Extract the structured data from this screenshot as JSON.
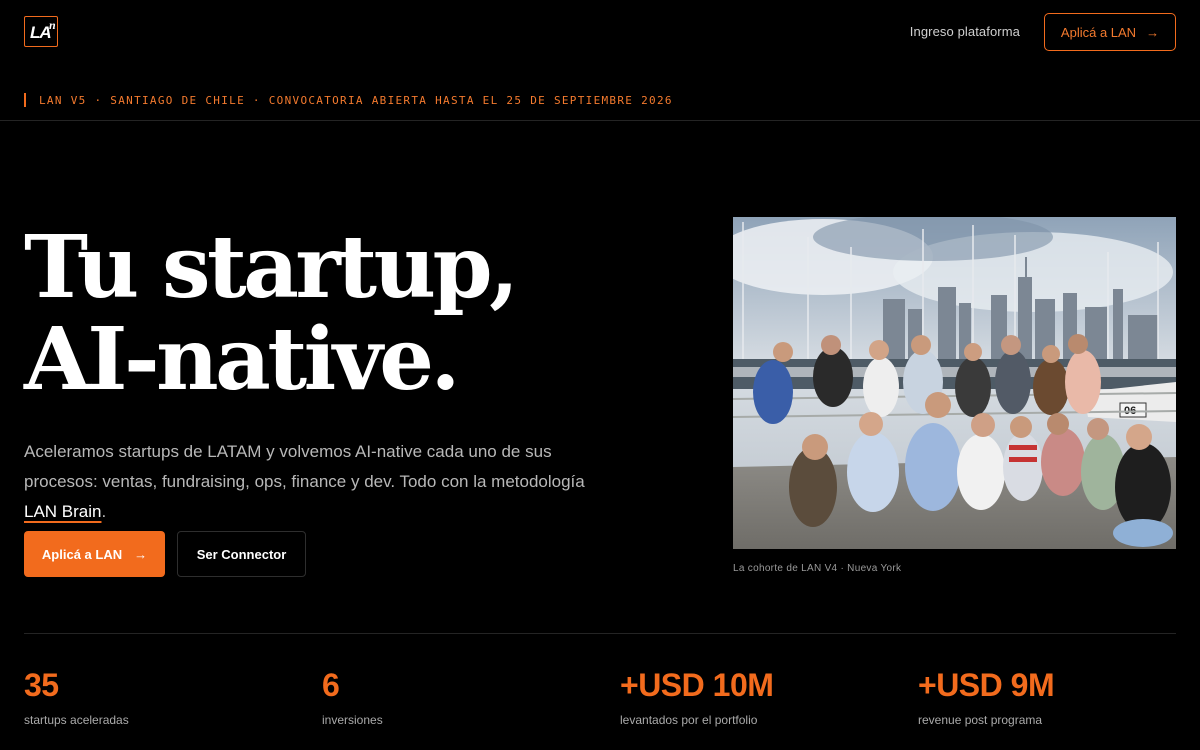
{
  "header": {
    "logo_text": "LA",
    "logo_sup": "n",
    "login_label": "Ingreso plataforma",
    "apply_label": "Aplicá a LAN",
    "apply_icon": "arrow-right-icon"
  },
  "announcement": "LAN V5 · SANTIAGO DE CHILE · CONVOCATORIA ABIERTA HASTA EL 25 DE SEPTIEMBRE 2026",
  "hero": {
    "title_line1": "Tu startup,",
    "title_line2": "AI-native.",
    "lead_part1": "Aceleramos startups de LATAM y volvemos AI-native cada uno de sus procesos: ventas, fundraising, ops, finance y dev. Todo con la metodología ",
    "lead_link": "LAN Brain",
    "lead_end": ".",
    "primary_cta": "Aplicá a LAN",
    "secondary_cta": "Ser Connector"
  },
  "photo": {
    "caption": "La cohorte de LAN V4 · Nueva York"
  },
  "stats": [
    {
      "value": "35",
      "label": "startups aceleradas"
    },
    {
      "value": "6",
      "label": "inversiones"
    },
    {
      "value": "+USD 10M",
      "label": "levantados por el portfolio"
    },
    {
      "value": "+USD 9M",
      "label": "revenue post programa"
    }
  ],
  "colors": {
    "accent": "#f26b1d",
    "background": "#000000",
    "muted_text": "#b8b8b8"
  }
}
